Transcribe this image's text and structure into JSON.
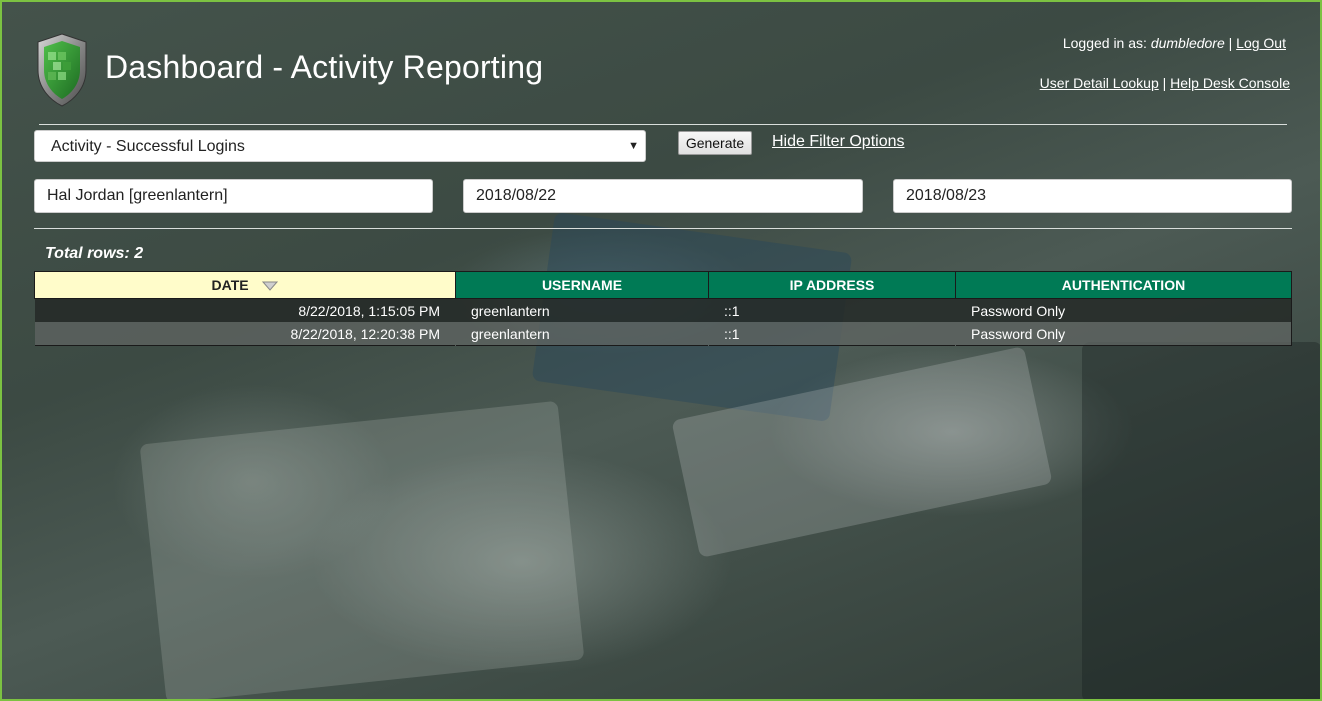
{
  "header": {
    "title": "Dashboard - Activity Reporting",
    "logged_in_prefix": "Logged in as: ",
    "username": "dumbledore",
    "logout_label": "Log Out",
    "link_user_lookup": "User Detail Lookup",
    "link_help_desk": "Help Desk Console",
    "separator": "|"
  },
  "filters": {
    "report_select_value": "Activity - Successful Logins",
    "generate_label": "Generate",
    "hide_filter_label": "Hide Filter Options",
    "user_value": "Hal Jordan [greenlantern]",
    "start_date": "2018/08/22",
    "end_date": "2018/08/23"
  },
  "results": {
    "total_label": "Total rows: 2",
    "columns": [
      "Date",
      "Username",
      "IP Address",
      "Authentication"
    ],
    "rows": [
      {
        "date": "8/22/2018, 1:15:05 PM",
        "username": "greenlantern",
        "ip": "::1",
        "auth": "Password Only"
      },
      {
        "date": "8/22/2018, 12:20:38 PM",
        "username": "greenlantern",
        "ip": "::1",
        "auth": "Password Only"
      }
    ]
  },
  "colors": {
    "header_green": "#007a55",
    "sorted_header": "#fffcca",
    "frame_border": "#7cc242"
  },
  "icons": {
    "logo": "shield-logo-icon",
    "sort": "sort-descending-icon",
    "select_arrow": "caret-down-icon"
  }
}
